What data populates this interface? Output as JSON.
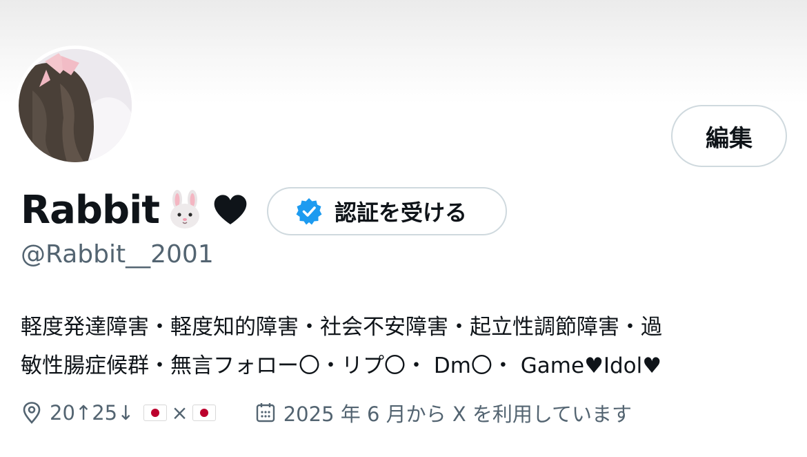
{
  "profile": {
    "display_name": "Rabbit",
    "emojis": [
      "rabbit-face-icon",
      "black-heart-icon"
    ],
    "handle": "@Rabbit__2001",
    "edit_label": "編集",
    "verify_label": "認証を受ける",
    "bio_lines": [
      "軽度発達障害・軽度知的障害・社会不安障害・起立性調節障害・過",
      "敏性腸症候群・無言フォロー〇・リプ〇・ Dm〇・ Game♥Idol♥"
    ],
    "location": {
      "icon": "location-pin-icon",
      "text": "20↑25↓",
      "separator": "×",
      "flags": [
        "japan-flag-icon",
        "japan-flag-icon"
      ]
    },
    "joined": {
      "icon": "calendar-icon",
      "text": "2025 年 6 月から X を利用しています"
    }
  },
  "colors": {
    "text_primary": "#0f1419",
    "text_secondary": "#536471",
    "border": "#cfd9de",
    "verified_blue": "#1d9bf0",
    "heart": "#0f1419"
  }
}
